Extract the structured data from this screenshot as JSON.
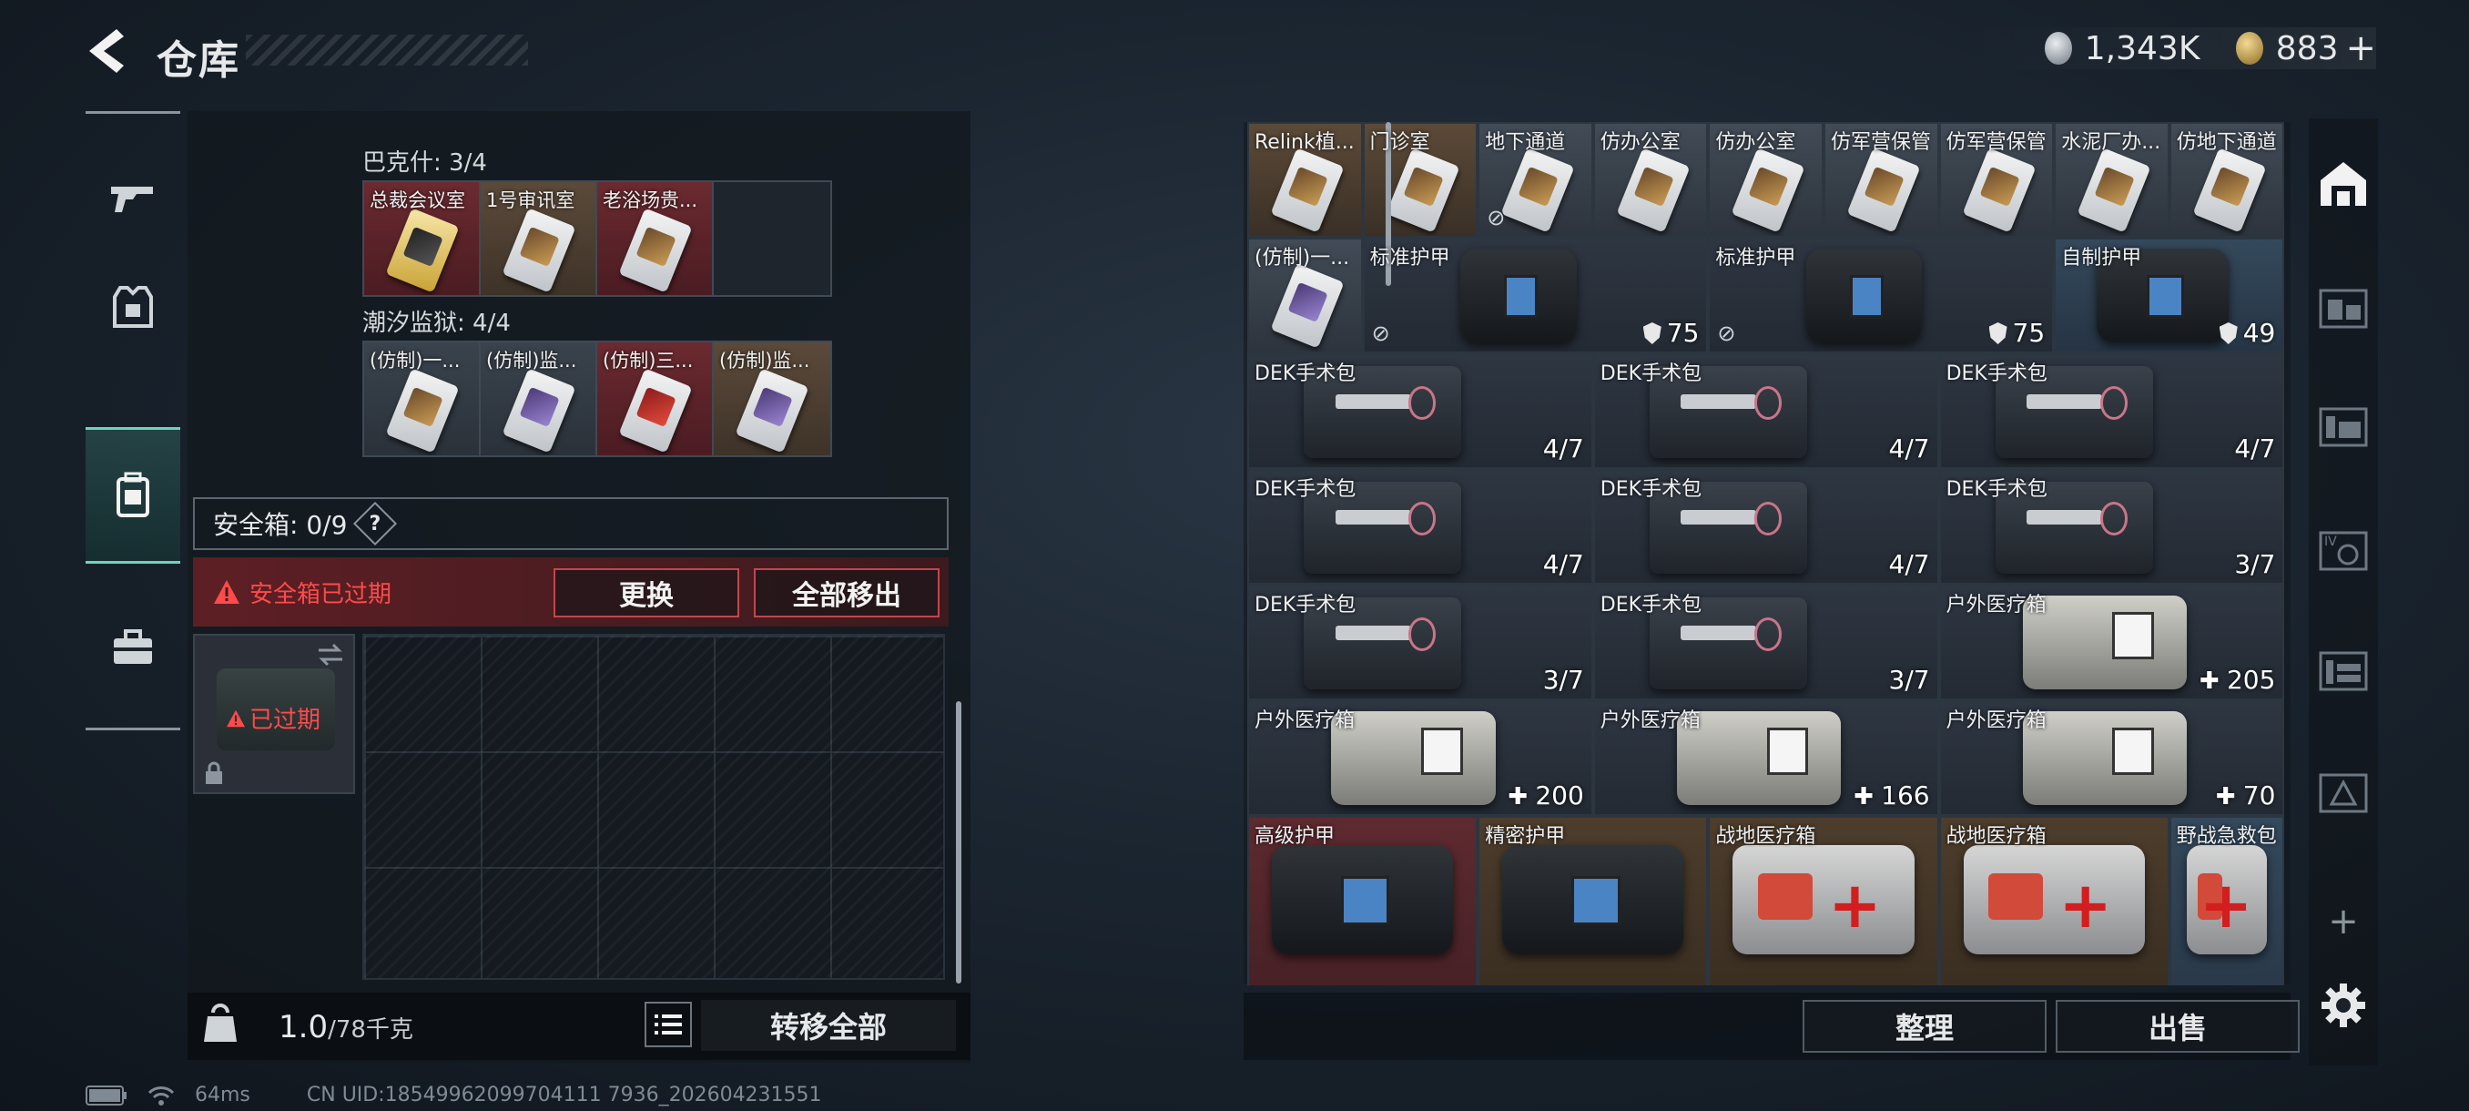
{
  "header": {
    "title": "仓库",
    "currency": [
      {
        "icon": "silver-coin-icon",
        "value": "1,343K"
      },
      {
        "icon": "gold-coin-icon",
        "value": "883"
      }
    ]
  },
  "left_rail": [
    "gun-icon",
    "armor-icon",
    "backpack-icon",
    "toolbox-icon"
  ],
  "left_panel": {
    "groups": [
      {
        "label": "巴克什: 3/4",
        "cards": [
          {
            "name": "总裁会议室",
            "bg": "red",
            "style": "gold"
          },
          {
            "name": "1号审讯室",
            "bg": "tan",
            "style": "plain"
          },
          {
            "name": "老浴场贵...",
            "bg": "red",
            "style": "plain"
          },
          {
            "name": "",
            "bg": "dark",
            "style": "empty"
          }
        ]
      },
      {
        "label": "潮汐监狱: 4/4",
        "cards": [
          {
            "name": "(仿制)一...",
            "bg": "gray",
            "style": "plain"
          },
          {
            "name": "(仿制)监...",
            "bg": "gray",
            "style": "purple"
          },
          {
            "name": "(仿制)三...",
            "bg": "red",
            "style": "redk"
          },
          {
            "name": "(仿制)监...",
            "bg": "tan",
            "style": "purple"
          }
        ]
      }
    ],
    "safe_label": "安全箱: 0/9",
    "help_label": "?",
    "warning": "安全箱已过期",
    "replace_button": "更换",
    "remove_all_button": "全部移出",
    "expired_label": "已过期",
    "weight_value": "1.0",
    "weight_capacity": "/78千克",
    "transfer_all_button": "转移全部"
  },
  "status_bar": {
    "ping": "64ms",
    "uid": "CN UID:18549962099704111 7936_202604231551"
  },
  "inventory": {
    "row1": [
      {
        "name": "Relink植...",
        "bg": "tan",
        "notrade": false
      },
      {
        "name": "门诊室",
        "bg": "tan",
        "notrade": false
      },
      {
        "name": "地下通道",
        "bg": "gray",
        "notrade": true
      },
      {
        "name": "仿办公室",
        "bg": "gray",
        "notrade": false
      },
      {
        "name": "仿办公室",
        "bg": "gray",
        "notrade": false
      },
      {
        "name": "仿军营保管",
        "bg": "gray",
        "notrade": false
      },
      {
        "name": "仿军营保管",
        "bg": "gray",
        "notrade": false
      },
      {
        "name": "水泥厂办...",
        "bg": "gray",
        "notrade": false
      },
      {
        "name": "仿地下通道",
        "bg": "gray",
        "notrade": false
      }
    ],
    "row2_card": {
      "name": "(仿制)一..."
    },
    "armors": [
      {
        "name": "标准护甲",
        "value": "75"
      },
      {
        "name": "标准护甲",
        "value": "75"
      },
      {
        "name": "自制护甲",
        "value": "49"
      }
    ],
    "kits": [
      {
        "name": "DEK手术包",
        "value": "4/7"
      },
      {
        "name": "DEK手术包",
        "value": "4/7"
      },
      {
        "name": "DEK手术包",
        "value": "4/7"
      },
      {
        "name": "DEK手术包",
        "value": "4/7"
      },
      {
        "name": "DEK手术包",
        "value": "4/7"
      },
      {
        "name": "DEK手术包",
        "value": "3/7"
      },
      {
        "name": "DEK手术包",
        "value": "3/7"
      },
      {
        "name": "DEK手术包",
        "value": "3/7"
      }
    ],
    "medboxes": [
      {
        "name": "户外医疗箱",
        "value": "205"
      },
      {
        "name": "户外医疗箱",
        "value": "200"
      },
      {
        "name": "户外医疗箱",
        "value": "166"
      },
      {
        "name": "户外医疗箱",
        "value": "70"
      }
    ],
    "bottom": [
      {
        "name": "高级护甲"
      },
      {
        "name": "精密护甲"
      },
      {
        "name": "战地医疗箱"
      },
      {
        "name": "战地医疗箱"
      },
      {
        "name": "野战急救包"
      }
    ],
    "sort_button": "整理",
    "sell_button": "出售"
  },
  "right_rail": [
    "warehouse-icon",
    "storage-1-icon",
    "storage-2-icon",
    "storage-4-icon",
    "storage-5-icon",
    "storage-6-icon",
    "add-icon",
    "settings-icon"
  ]
}
